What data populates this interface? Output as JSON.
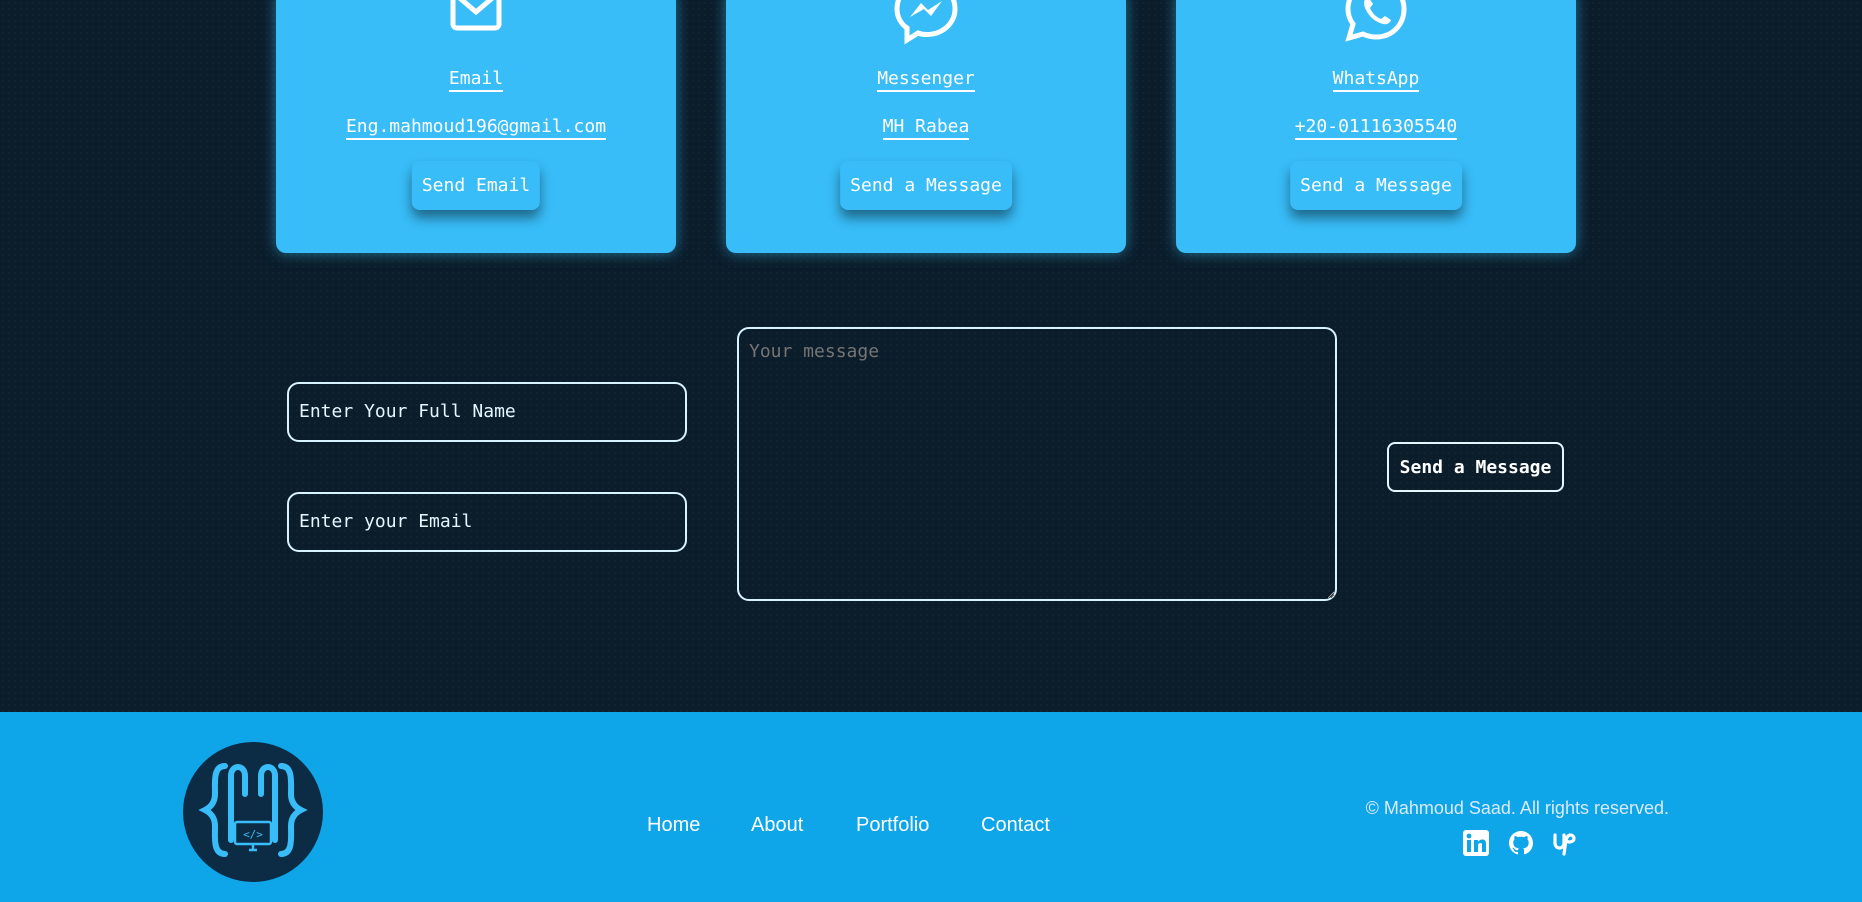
{
  "cards": [
    {
      "title": "Email",
      "value": "Eng.mahmoud196@gmail.com",
      "button": "Send Email",
      "icon": "envelope-icon"
    },
    {
      "title": "Messenger",
      "value": "MH Rabea",
      "button": "Send a Message",
      "icon": "messenger-icon"
    },
    {
      "title": "WhatsApp",
      "value": "+20-01116305540",
      "button": "Send a Message",
      "icon": "whatsapp-icon"
    }
  ],
  "form": {
    "name_placeholder": "Enter Your Full Name",
    "email_placeholder": "Enter your Email",
    "message_placeholder": "Your message",
    "submit_label": "Send a Message"
  },
  "footer": {
    "nav": [
      "Home",
      "About",
      "Portfolio",
      "Contact"
    ],
    "copyright": "© Mahmoud Saad. All rights reserved.",
    "social": [
      "linkedin-icon",
      "github-icon",
      "upwork-icon"
    ],
    "logo": "logo-icon"
  },
  "colors": {
    "background": "#0b1d2b",
    "card": "#38bdf8",
    "footer": "#0ea5e9",
    "logo_bg": "#0c2c45"
  }
}
